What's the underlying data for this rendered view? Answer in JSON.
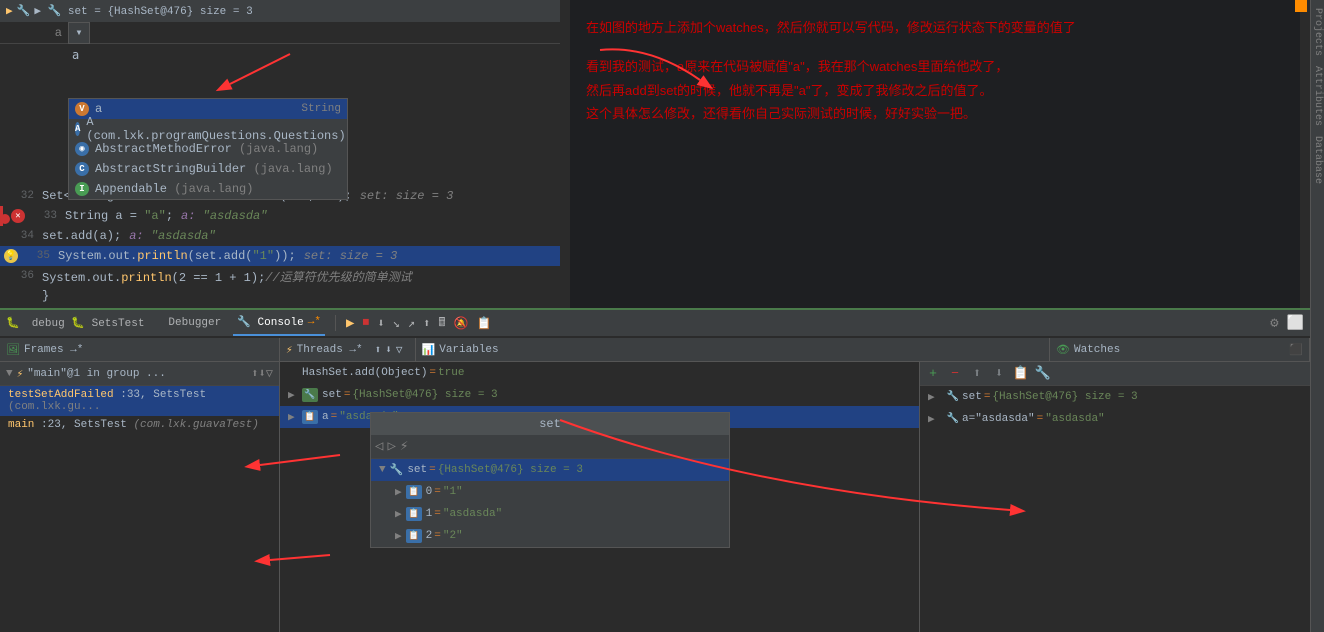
{
  "editor": {
    "title": "SetsTest",
    "debug_label": "debug",
    "lines": [
      {
        "num": "",
        "content": "▶ 🔧 set = {HashSet@476}  size = 3",
        "type": "debug-top"
      },
      {
        "num": "",
        "content": "a",
        "type": "input-bar"
      }
    ],
    "code_lines": [
      {
        "num": "32",
        "content": "Set<String> set = Sets.newHashSet(\"1\",\"2\");",
        "annotation": "set:  size = 3",
        "type": "normal"
      },
      {
        "num": "33",
        "content": "String a = \"a\";",
        "annotation": "a: \"asdasda\"",
        "type": "normal",
        "has_breakpoint": true
      },
      {
        "num": "34",
        "content": "set.add(a);",
        "annotation": "a: \"asdasda\"",
        "type": "normal"
      },
      {
        "num": "35",
        "content": "System.out.println(set.add(\"1\"));",
        "annotation": "set:  size = 3",
        "type": "highlight-blue",
        "has_lamp": true
      },
      {
        "num": "36",
        "content": "System.out.println(2 == 1 + 1);//运算符优先级的简单测试",
        "type": "normal"
      },
      {
        "num": "",
        "content": "}",
        "type": "normal"
      }
    ]
  },
  "autocomplete": {
    "items": [
      {
        "icon": "V",
        "icon_color": "orange",
        "text": "a",
        "type_info": "String"
      },
      {
        "icon": "A",
        "icon_color": "blue",
        "text": "A (com.lxk.programQuestions.Questions)",
        "sub": ""
      },
      {
        "icon": "M",
        "icon_color": "blue",
        "text": "AbstractMethodError (java.lang)",
        "sub": ""
      },
      {
        "icon": "C",
        "icon_color": "blue",
        "text": "AbstractStringBuilder (java.lang)",
        "sub": ""
      },
      {
        "icon": "I",
        "icon_color": "blue",
        "text": "Appendable (java.lang)",
        "sub": ""
      }
    ]
  },
  "annotation_panel": {
    "line1": "在如图的地方上添加个watches，然后你就可以写代码，修改运行状态下的变量的值了",
    "line2": "",
    "line3": "看到我的测试，a原来在代码被赋值\"a\"，我在那个watches里面给他改了，",
    "line4": "然后再add到set的时候，他就不再是\"a\"了，变成了我修改之后的值了。",
    "line5": "这个具体怎么修改，还得看你自己实际测试的时候，好好实验一把。"
  },
  "debug_bar": {
    "title": "debug  🐛 SetsTest",
    "tabs": [
      {
        "label": "Debugger",
        "active": false
      },
      {
        "label": "🔧 Console →*",
        "active": true
      }
    ],
    "buttons": [
      "⏩",
      "▶",
      "⏹",
      "⏸",
      "⬇",
      "⬆",
      "↘",
      "↗",
      "🔄",
      "⚡"
    ]
  },
  "frames_panel": {
    "header": "Frames →*",
    "threads_label": "Threads →*",
    "items": [
      {
        "method": "\"main\"@1 in group ...",
        "selected": false,
        "is_thread": true
      },
      {
        "method": "testSetAddFailed:33, SetsTest",
        "package": "(com.lxk.gu...",
        "selected": true
      },
      {
        "method": "main:23, SetsTest",
        "package": "(com.lxk.guavaTest)",
        "selected": false
      }
    ]
  },
  "variables_panel": {
    "header": "Variables",
    "items": [
      {
        "key": "HashSet.add(Object)",
        "value": "= true",
        "level": 0
      },
      {
        "key": "▶ 🔧 set",
        "value": "= {HashSet@476}  size = 3",
        "level": 0
      },
      {
        "key": "▶ 📋 a",
        "value": "= \"asdasda\"",
        "level": 0,
        "selected": true
      }
    ],
    "popup": {
      "title": "set",
      "items": [
        {
          "key": "🔧 set",
          "value": "= {HashSet@476}  size = 3",
          "level": 0,
          "selected": true,
          "expanded": true
        },
        {
          "key": "0",
          "value": "= \"1\"",
          "level": 1
        },
        {
          "key": "1",
          "value": "= \"asdasda\"",
          "level": 1
        },
        {
          "key": "2",
          "value": "= \"2\"",
          "level": 1
        }
      ]
    }
  },
  "watches_panel": {
    "header": "Watches",
    "buttons": [
      "+",
      "-",
      "↑",
      "↓",
      "📋",
      "🔧"
    ],
    "items": [
      {
        "key": "🔧 set",
        "value": "= {HashSet@476}  size = 3",
        "expanded": false
      },
      {
        "key": "🔧 a=\"asdasda\"",
        "value": "= \"asdasda\"",
        "expanded": false
      }
    ]
  },
  "right_sidebar": {
    "tabs": [
      "Projects",
      "Attributes",
      "Database"
    ]
  },
  "settings_icon": "⚙",
  "gear_label": "⚙"
}
